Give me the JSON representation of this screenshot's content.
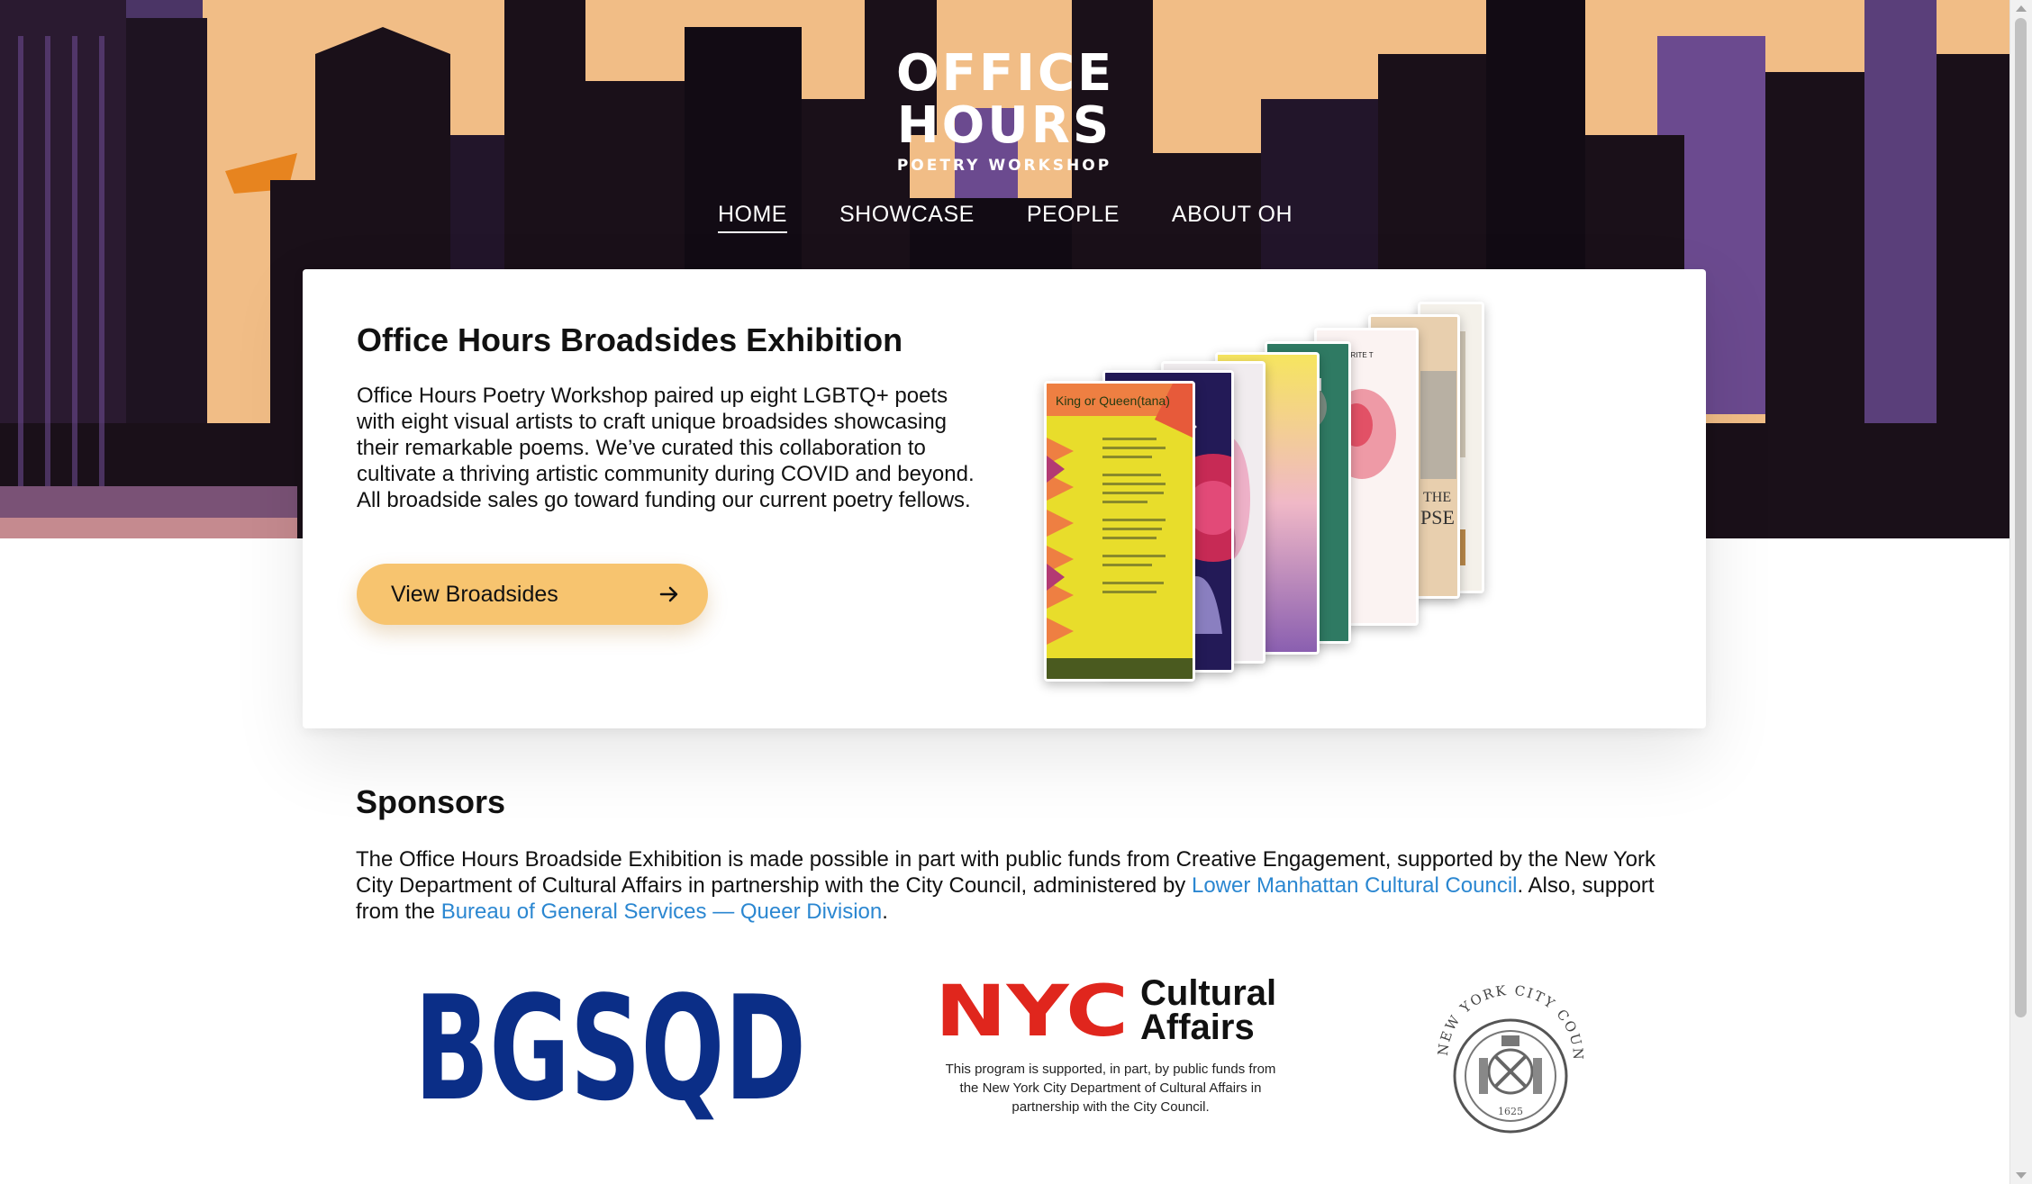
{
  "logo": {
    "line1": "OFFICE",
    "line2": "HOURS",
    "line3": "POETRY WORKSHOP"
  },
  "nav": {
    "items": [
      "HOME",
      "SHOWCASE",
      "PEOPLE",
      "ABOUT OH"
    ],
    "active": "HOME"
  },
  "exhibition": {
    "title": "Office Hours Broadsides Exhibition",
    "body": "Office Hours Poetry Workshop paired up eight LGBTQ+ poets with eight visual artists to craft unique broadsides showcasing their remarkable poems. We’ve curated this collaboration to cultivate a thriving artistic community during COVID and beyond. All broadside sales go toward funding our current poetry fellows.",
    "button_label": "View Broadsides",
    "button_icon": "arrow-right-icon",
    "front_poster_title": "King or Queen(tana)",
    "poster_text_1": "SAY I WRITE T",
    "poster_text_2": "THE",
    "poster_text_3": "PSE"
  },
  "sponsors": {
    "title": "Sponsors",
    "text_1": "The Office Hours Broadside Exhibition is made possible in part with public funds from Creative Engagement, supported by the New York City Department of Cultural Affairs in partnership with the City Council, administered by ",
    "link_1": "Lower Manhattan Cultural Council",
    "text_2": ". Also, support from the ",
    "link_2": "Bureau of General Services — Queer Division",
    "text_3": ".",
    "bgsqd_logo_text": "BGSQD",
    "nyc_logo_nyc": "NYC",
    "nyc_logo_cultural": "Cultural",
    "nyc_logo_affairs": "Affairs",
    "nyc_caption": "This program is supported, in part, by public funds from the New York City Department of Cultural Affairs in partnership with the City Council.",
    "council_text": "NEW YORK CITY COUNCIL",
    "council_year": "1625"
  },
  "colors": {
    "sky": "#f1bd86",
    "building": "#1a1019",
    "building_purple": "#5b3f78",
    "button": "#f7c46f",
    "link": "#2b87d1",
    "bgsqd_blue": "#0b2e87",
    "nyc_red": "#e0261d"
  }
}
